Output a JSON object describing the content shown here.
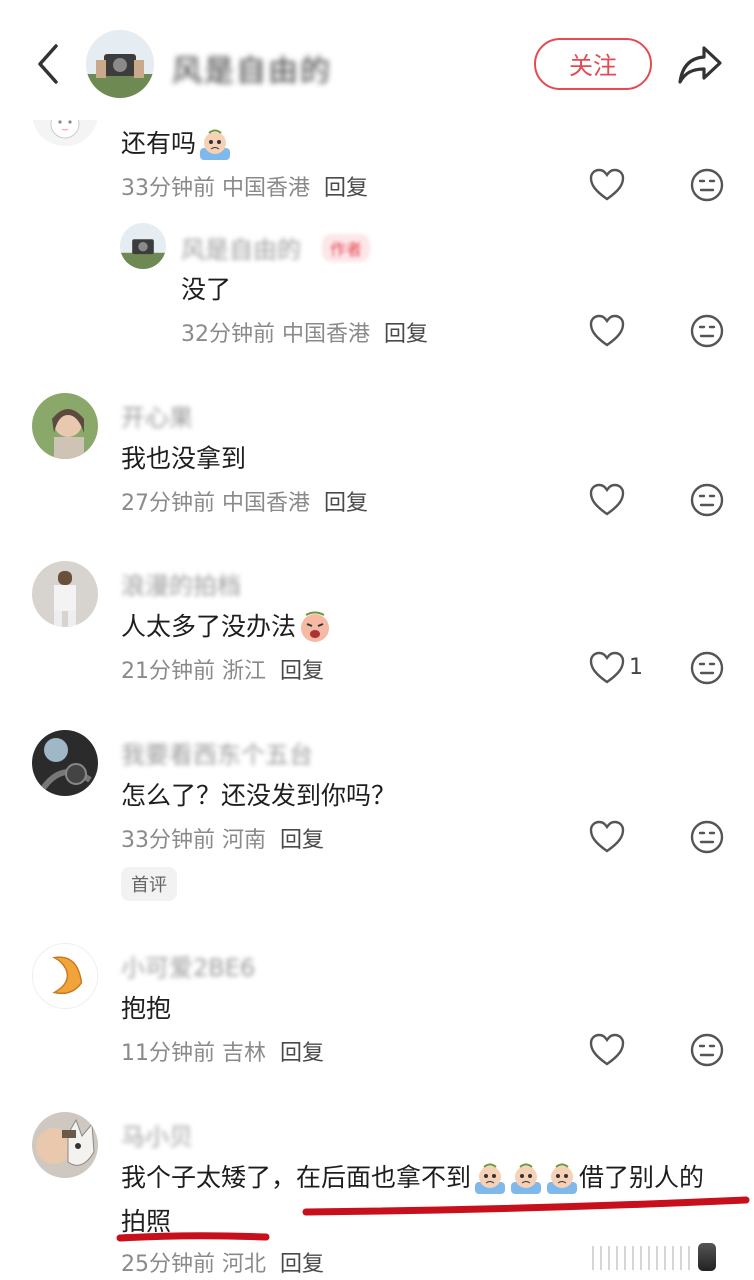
{
  "header": {
    "back_icon": "chevron-left-icon",
    "username": "风是自由的",
    "follow_label": "关注",
    "share_icon": "share-arrow-icon"
  },
  "comments": [
    {
      "user": "",
      "text": "还有吗",
      "emoji": "crying-emoji",
      "time": "33分钟前",
      "location": "中国香港",
      "reply": "回复"
    },
    {
      "user": "风是自由的",
      "author_badge": "作者",
      "text": "没了",
      "time": "32分钟前",
      "location": "中国香港",
      "reply": "回复"
    },
    {
      "user": "开心果",
      "text": "我也没拿到",
      "time": "27分钟前",
      "location": "中国香港",
      "reply": "回复"
    },
    {
      "user": "浪漫的拍档",
      "text": "人太多了没办法",
      "emoji": "sob-emoji",
      "time": "21分钟前",
      "location": "浙江",
      "reply": "回复",
      "likes": "1"
    },
    {
      "user": "我要看西东个五台",
      "text": "怎么了？还没发到你吗？",
      "time": "33分钟前",
      "location": "河南",
      "reply": "回复",
      "badge": "首评"
    },
    {
      "user": "小可爱2BE6",
      "text": "抱抱",
      "time": "11分钟前",
      "location": "吉林",
      "reply": "回复"
    },
    {
      "user": "马小贝",
      "text_line1_a": "我个子太矮了，在后面也拿不到",
      "text_line1_b": "借了别人的",
      "text_line2": "拍照",
      "time": "25分钟前",
      "location": "河北",
      "reply": "回复"
    }
  ],
  "colors": {
    "accent": "#e44a54",
    "underline": "#c8101c",
    "meta": "#8a8a8a"
  }
}
